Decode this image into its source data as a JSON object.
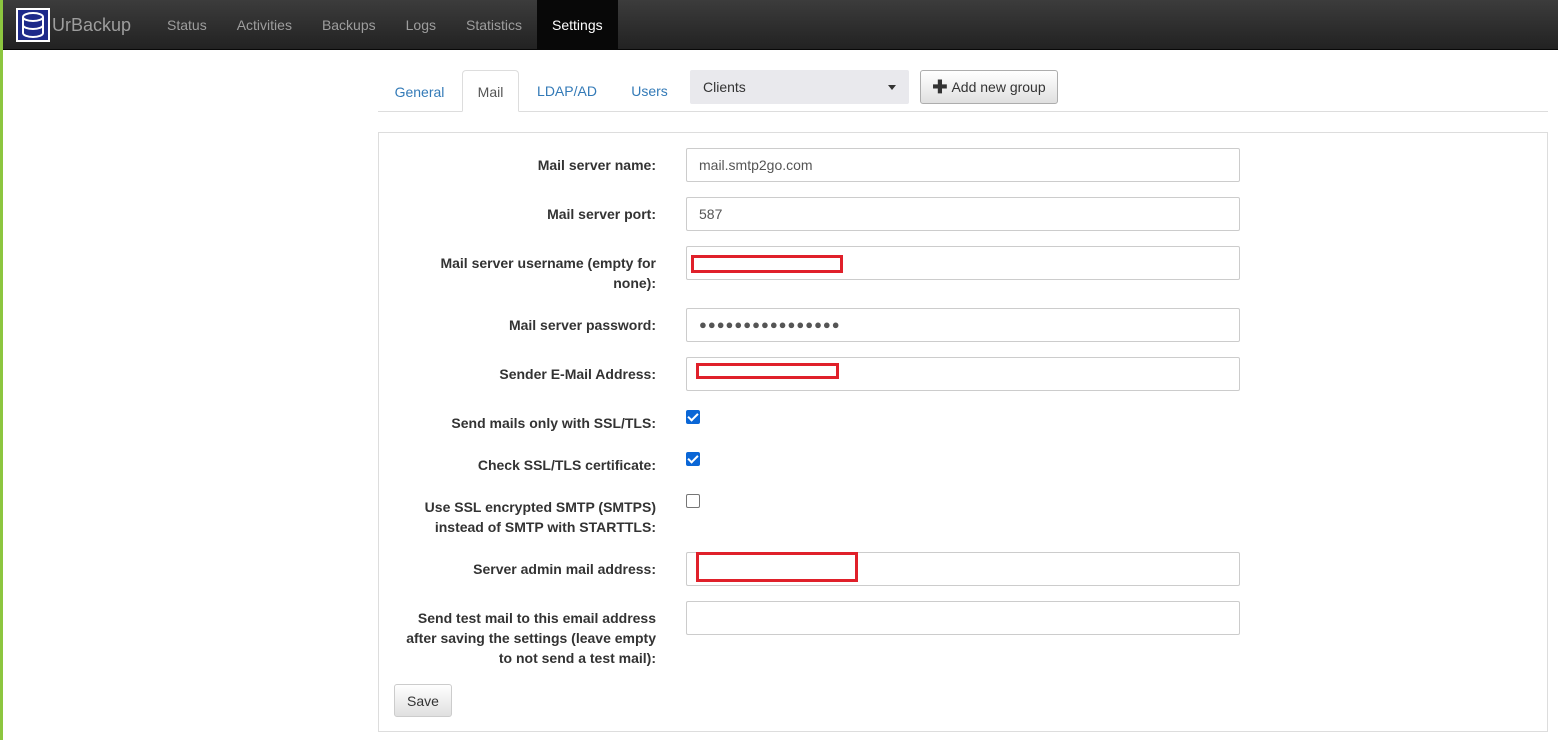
{
  "app": {
    "brand": "UrBackup",
    "logo_icon": "database-icon"
  },
  "nav": {
    "items": [
      {
        "label": "Status"
      },
      {
        "label": "Activities"
      },
      {
        "label": "Backups"
      },
      {
        "label": "Logs"
      },
      {
        "label": "Statistics"
      },
      {
        "label": "Settings",
        "active": true
      }
    ]
  },
  "tabs": {
    "items": [
      {
        "label": "General"
      },
      {
        "label": "Mail",
        "active": true
      },
      {
        "label": "LDAP/AD"
      },
      {
        "label": "Users"
      }
    ],
    "group_select": {
      "value": "Clients"
    },
    "add_group_label": "Add new group"
  },
  "form": {
    "mail_server_name": {
      "label": "Mail server name:",
      "value": "mail.smtp2go.com"
    },
    "mail_server_port": {
      "label": "Mail server port:",
      "value": "587"
    },
    "mail_server_username": {
      "label_line1": "Mail server username (empty for",
      "label_line2": "none):",
      "value": "[redacted]"
    },
    "mail_server_password": {
      "label": "Mail server password:",
      "value": "●●●●●●●●●●●●●●●●"
    },
    "sender_email": {
      "label": "Sender E-Mail Address:",
      "value": "[redacted]"
    },
    "ssl_only": {
      "label": "Send mails only with SSL/TLS:",
      "checked": true
    },
    "check_cert": {
      "label": "Check SSL/TLS certificate:",
      "checked": true
    },
    "smtps": {
      "label_line1": "Use SSL encrypted SMTP (SMTPS)",
      "label_line2": "instead of SMTP with STARTTLS:",
      "checked": false
    },
    "admin_mail": {
      "label": "Server admin mail address:",
      "value": "[redacted]"
    },
    "test_mail": {
      "label_line1": "Send test mail to this email address",
      "label_line2": "after saving the settings (leave empty",
      "label_line3": "to not send a test mail):",
      "value": ""
    },
    "save_label": "Save"
  },
  "colors": {
    "accent": "#337ab7",
    "navbar": "#222222",
    "redaction": "#e0202a",
    "checkbox": "#0a66d6",
    "left_border": "#8cc63f"
  }
}
